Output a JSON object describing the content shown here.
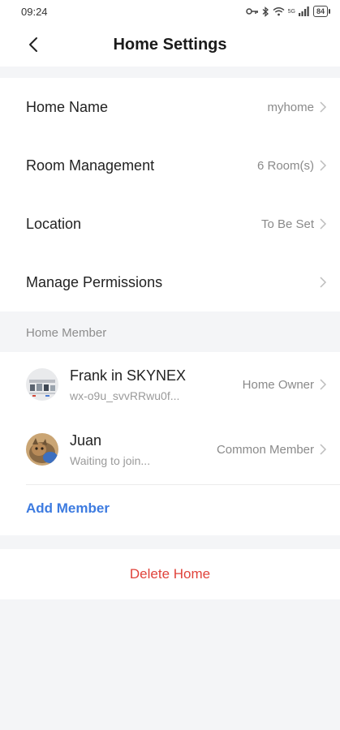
{
  "status_bar": {
    "time": "09:24",
    "network": "5G",
    "battery": "84"
  },
  "header": {
    "title": "Home Settings",
    "back_icon": "chevron-left-icon"
  },
  "settings": {
    "home_name": {
      "label": "Home Name",
      "value": "myhome"
    },
    "room_management": {
      "label": "Room Management",
      "value": "6 Room(s)"
    },
    "location": {
      "label": "Location",
      "value": "To Be Set"
    },
    "permissions": {
      "label": "Manage Permissions",
      "value": ""
    }
  },
  "members": {
    "section_label": "Home Member",
    "items": [
      {
        "name": "Frank in SKYNEX",
        "sub": "wx-o9u_svvRRwu0f...",
        "role": "Home Owner"
      },
      {
        "name": "Juan",
        "sub": "Waiting to join...",
        "role": "Common Member"
      }
    ],
    "add_label": "Add Member"
  },
  "actions": {
    "delete_label": "Delete Home"
  },
  "colors": {
    "accent_blue": "#3d7be0",
    "danger_red": "#e0433b",
    "background": "#f4f5f7"
  }
}
